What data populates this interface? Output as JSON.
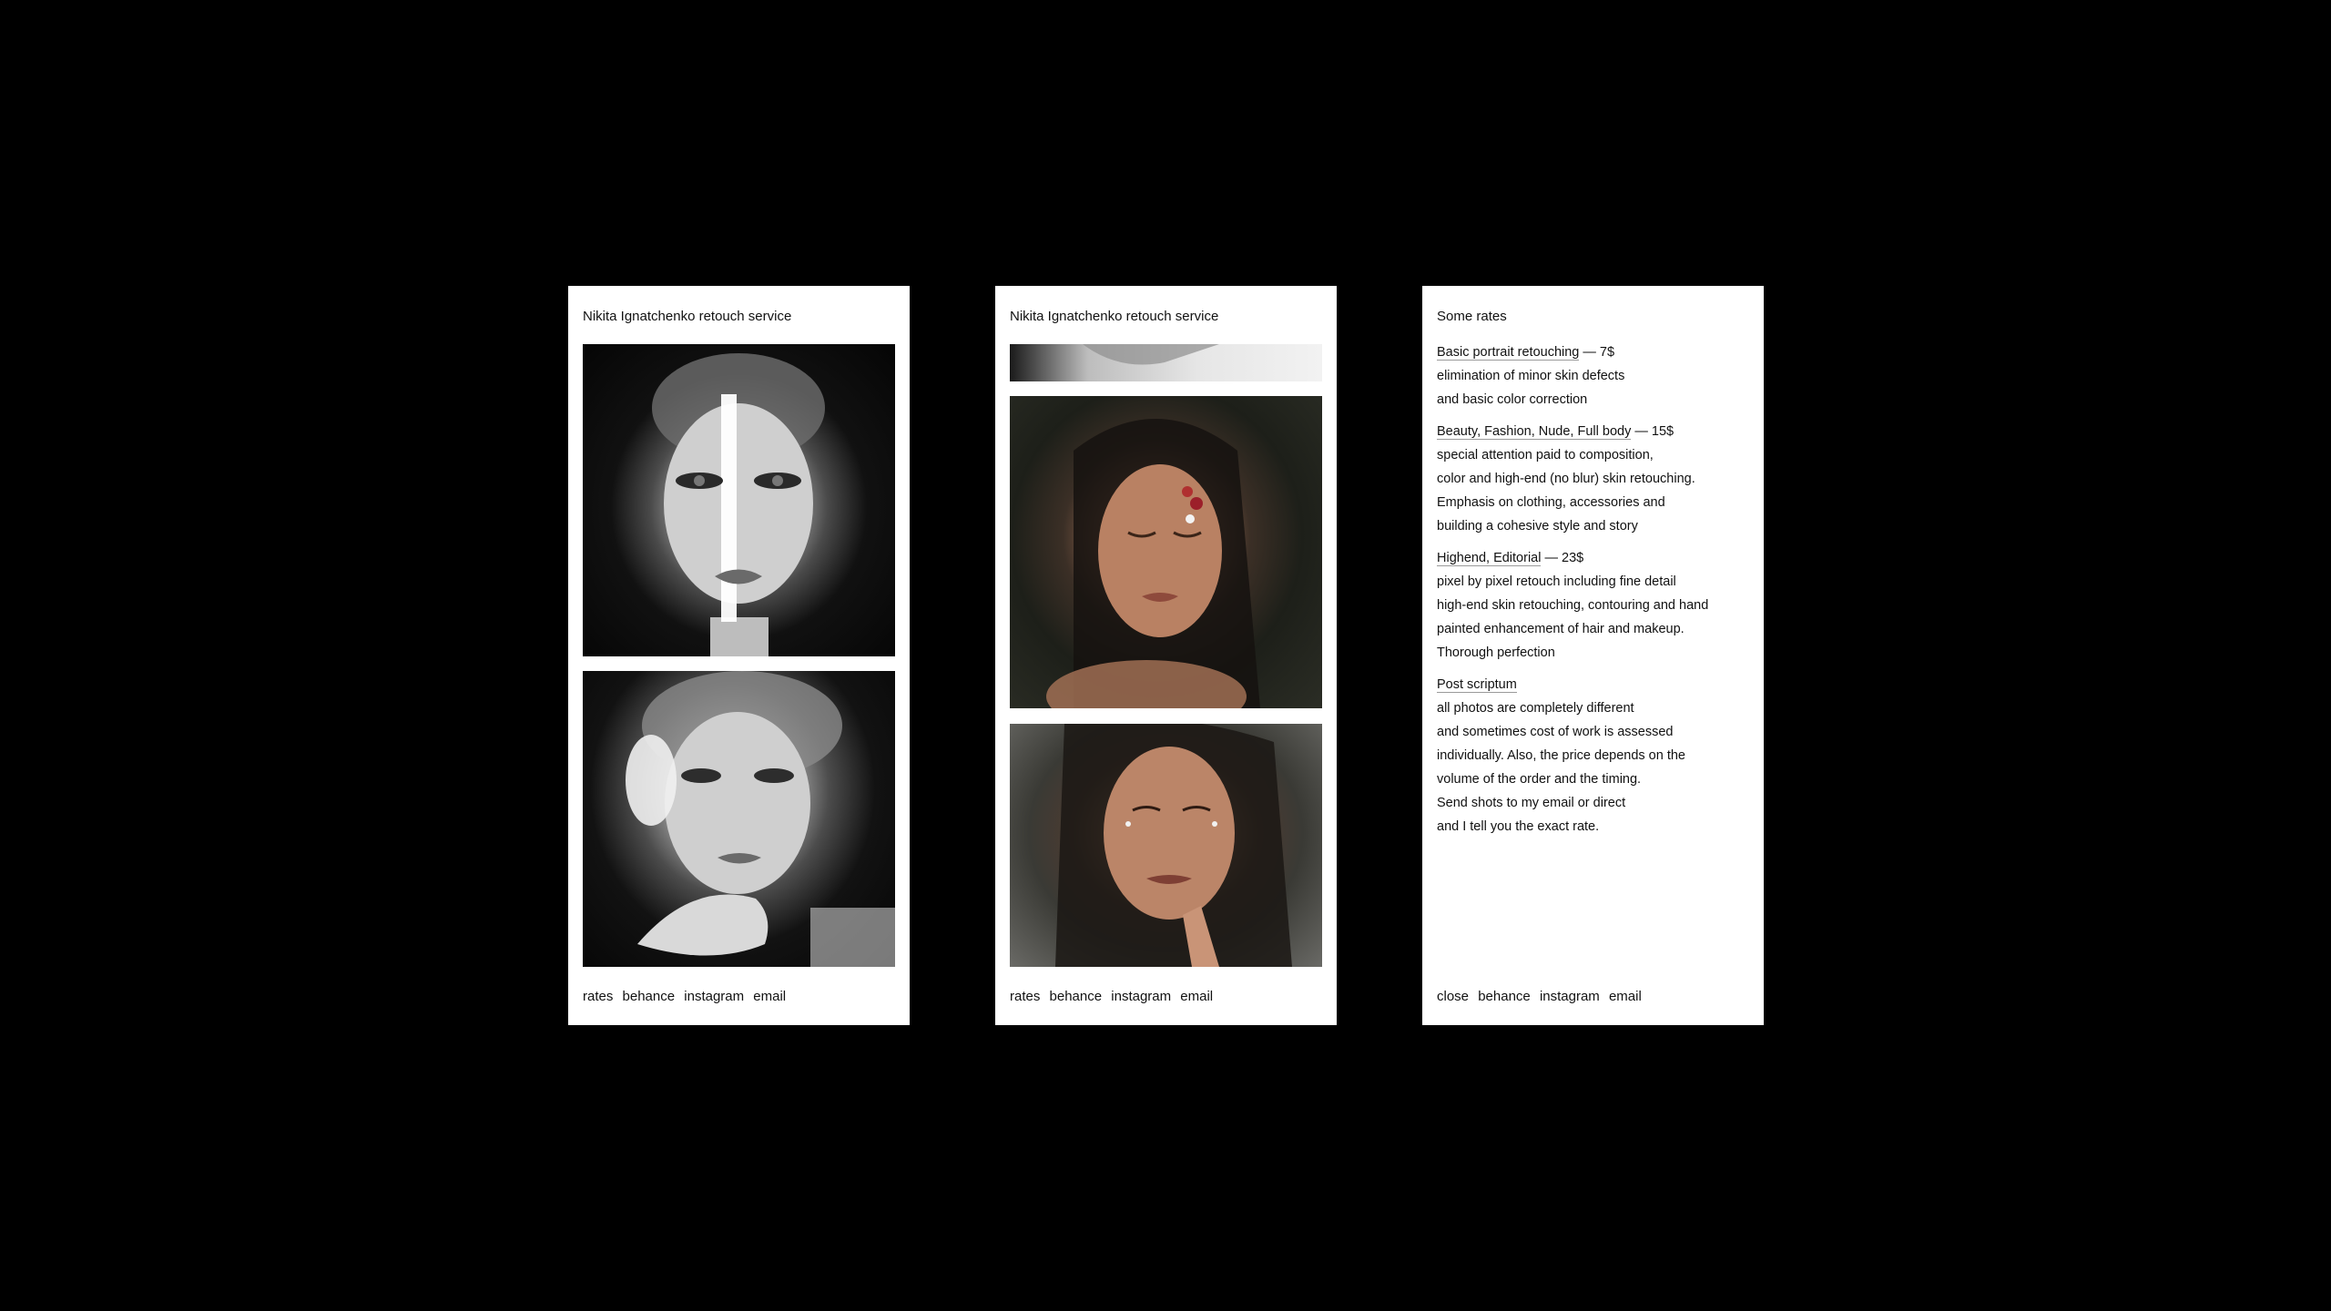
{
  "colors": {
    "background": "#000000",
    "card": "#ffffff",
    "text": "#111111"
  },
  "screen1": {
    "title": "Nikita Ignatchenko retouch service",
    "photos": [
      "bw-portrait-stripe",
      "bw-portrait-glitter"
    ],
    "footer": {
      "rates": "rates",
      "behance": "behance",
      "instagram": "instagram",
      "email": "email"
    }
  },
  "screen2": {
    "title": "Nikita Ignatchenko retouch service",
    "photos": [
      "bw-hand-crop",
      "color-portrait-eyes-closed",
      "color-portrait-hand-chin"
    ],
    "footer": {
      "rates": "rates",
      "behance": "behance",
      "instagram": "instagram",
      "email": "email"
    }
  },
  "screen3": {
    "title": "Some rates",
    "rates": [
      {
        "head_underlined": "Basic portrait retouching",
        "head_rest": " — 7$",
        "lines": [
          "elimination of minor skin defects",
          "and basic color correction"
        ]
      },
      {
        "head_underlined": "Beauty, Fashion,  Nude, Full body",
        "head_rest": " — 15$",
        "lines": [
          "special attention paid to composition,",
          "color and high-end (no blur) skin retouching.",
          "Emphasis on clothing, accessories and",
          "building a cohesive style and story"
        ]
      },
      {
        "head_underlined": "Highend, Editorial",
        "head_rest": " — 23$",
        "lines": [
          "pixel by pixel retouch including fine detail",
          "high-end skin retouching, contouring and hand",
          "painted enhancement of hair and makeup.",
          "Thorough perfection"
        ]
      },
      {
        "head_underlined": "Post scriptum",
        "head_rest": "",
        "lines": [
          "all photos are completely different",
          "and sometimes cost of work is assessed",
          "individually. Also, the price depends on the",
          "volume of the order and the timing.",
          "Send shots to my email or direct",
          "and I tell you the exact rate."
        ]
      }
    ],
    "footer": {
      "close": "close",
      "behance": "behance",
      "instagram": "instagram",
      "email": "email"
    }
  }
}
